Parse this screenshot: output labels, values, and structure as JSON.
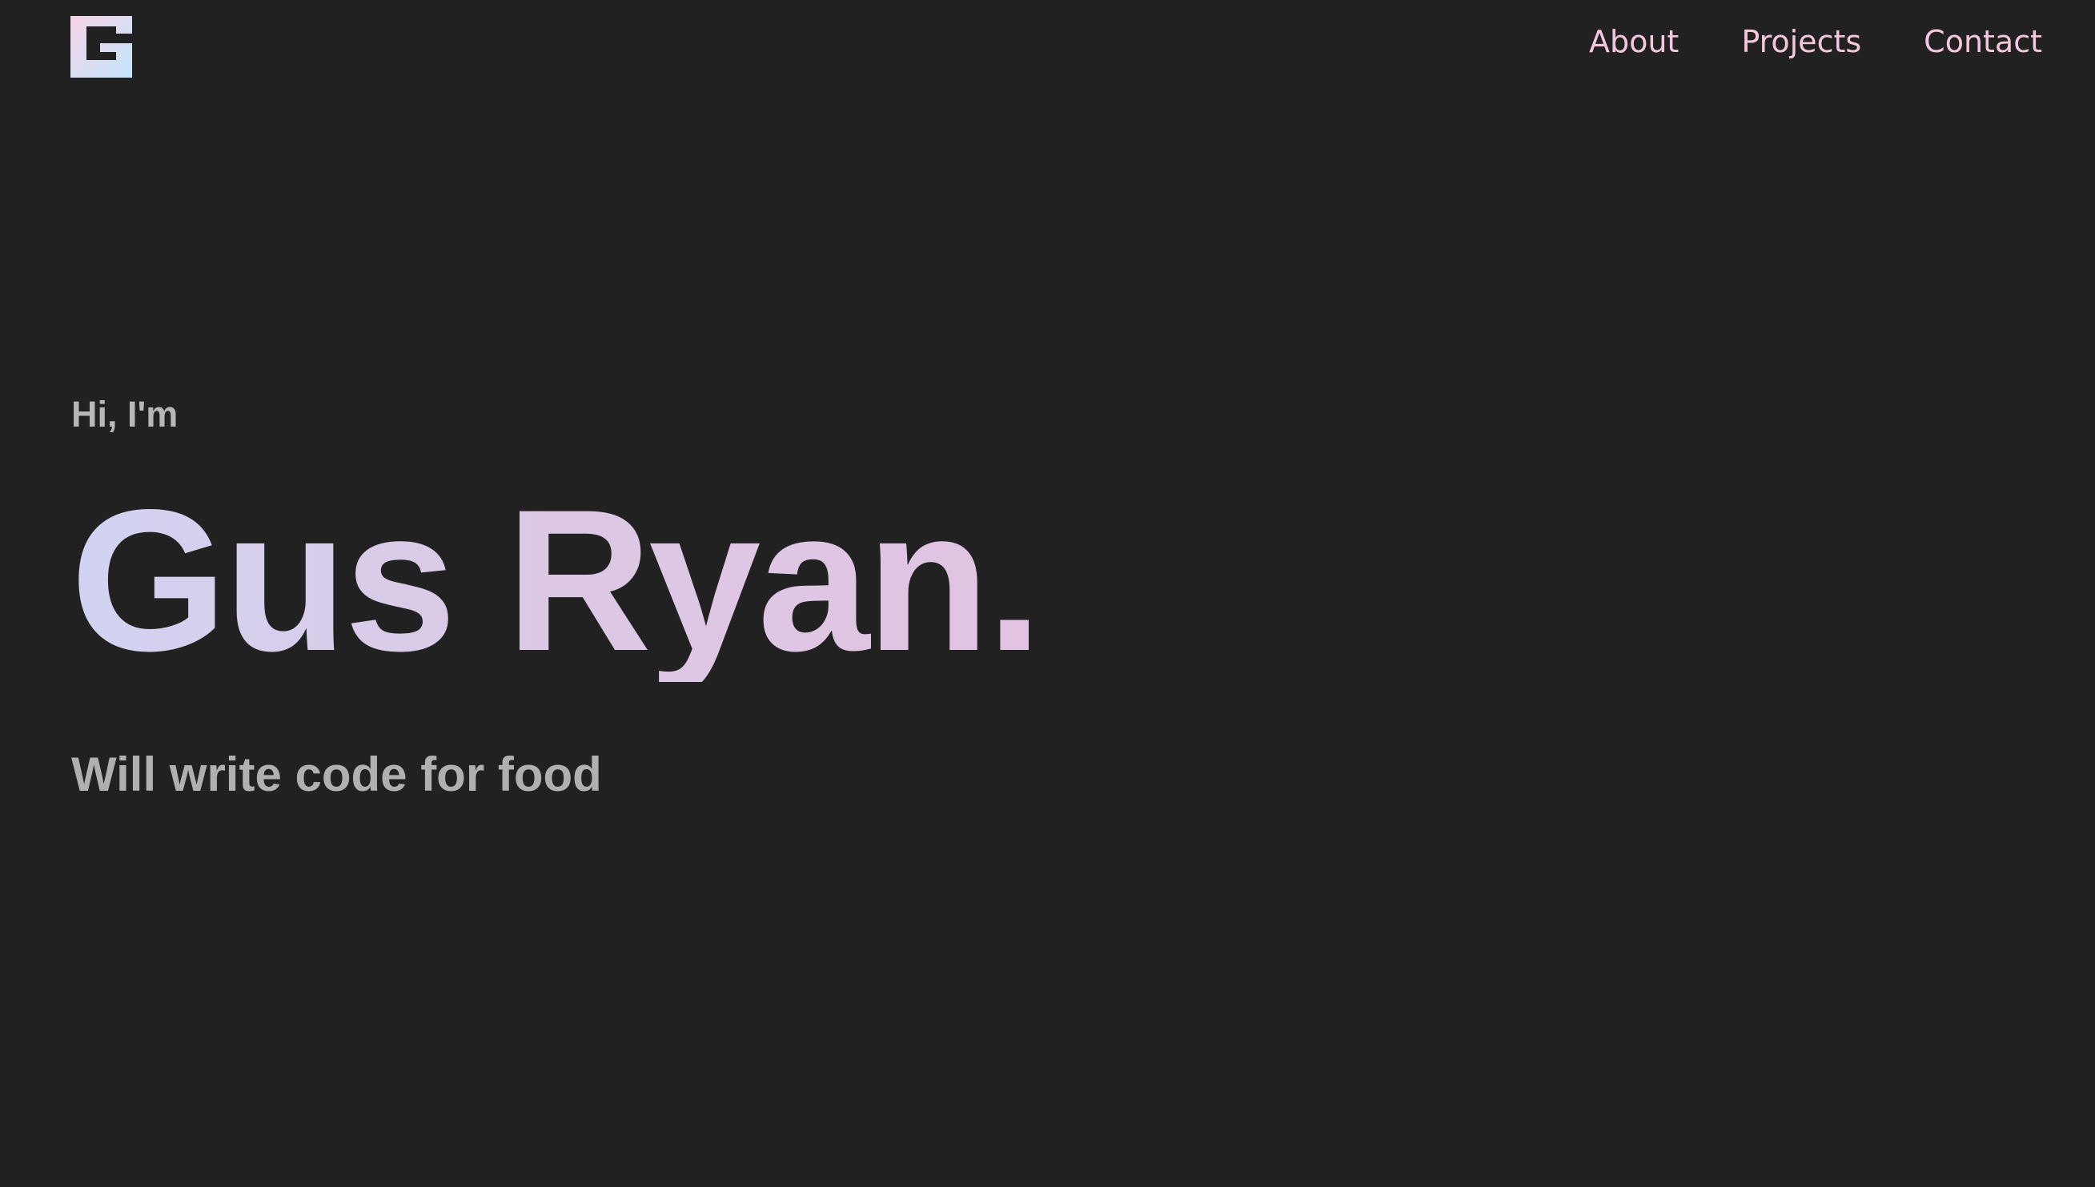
{
  "header": {
    "logo_icon": "g-monogram-logo",
    "nav": [
      {
        "label": "About"
      },
      {
        "label": "Projects"
      },
      {
        "label": "Contact"
      }
    ]
  },
  "hero": {
    "greeting": "Hi, I'm",
    "name": "Gus Ryan.",
    "tagline": "Will write code for food"
  },
  "colors": {
    "background": "#212121",
    "nav_link": "#f4c7dc",
    "greeting": "#b8b8b8",
    "name_gradient_start": "#d2d3f2",
    "name_gradient_end": "#e2c3e2",
    "tagline": "#b0b0b0",
    "logo_gradient_start": "#f6d3e6",
    "logo_gradient_end": "#c3e4fb"
  }
}
